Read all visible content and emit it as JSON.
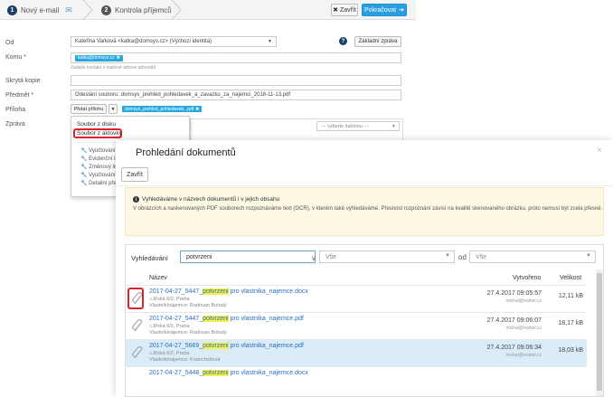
{
  "steps": [
    {
      "num": "1",
      "label": "Nový e-mail"
    },
    {
      "num": "2",
      "label": "Kontrola příjemců"
    }
  ],
  "toolbar": {
    "close_label": "Zavřít",
    "continue_label": "Pokračovat"
  },
  "form": {
    "from_label": "Od",
    "from_value": "Kateřina Varková <katka@domsys.cz> (Výchozí identita)",
    "basic_view_label": "Základní zpráva",
    "to_label": "Komu *",
    "to_chip": "katka@domsys.cz",
    "to_hint": "Zadejte kontakt v mailové adrese adresátů",
    "bcc_label": "Skrytá kopie",
    "subject_label": "Předmět *",
    "subject_value": "Odeslání souboru: domsys_prehled_pohledavek_a_zavazku_za_najemci_2018-11-13.pdf",
    "attachment_label": "Příloha",
    "attach_button": "Přidat přílohu",
    "attach_chip": "domsys_prehled_pohledavek...pdf",
    "message_label": "Zpráva",
    "template_select": "--- vyberte šablonu ---"
  },
  "dropdown": {
    "file_from_disk": "Soubor z disku",
    "file_from_dossier": "Soubor z aktovky",
    "sub_items": [
      "Vyúčtování z...",
      "Evidenční list",
      "Změnový list",
      "Vyúčtování fo",
      "Detailní přeh"
    ]
  },
  "modal": {
    "title": "Prohledání dokumentů",
    "close_button": "Zavřít",
    "close_x": "×",
    "info_title": "Vyhledáváme v názvech dokumentů i v jejich obsahu",
    "info_text": "V obrázcích a naskenovaných PDF souborech rozpoznáváme text (OCR), v kterém také vyhledáváme. Přesnost rozpoznání závisí na kvalitě skenovaného obrázku, proto nemusí být zcela přesné.",
    "search_label": "Vyhledávání",
    "search_value": "potvrzeni",
    "in_label": "v",
    "in_select": "Vše",
    "from_label": "od",
    "from_select": "Vše",
    "columns": {
      "name": "Název",
      "created": "Vytvořeno",
      "size": "Velikost"
    },
    "rows": [
      {
        "prefix": "2017-04-27_5447_",
        "highlight": "potvrzeni",
        "suffix": " pro vlastnika_najemce.docx",
        "line1": "Jiřská 6/2, Praha",
        "line2": "Vlastník/nájemce: Radovan Bohatý",
        "date": "27.4.2017 09:05:57",
        "user": "michal@vrabel.cz",
        "size": "12,11 kB"
      },
      {
        "prefix": "2017-04-27_5447_",
        "highlight": "potvrzeni",
        "suffix": " pro vlastnika_najemce.pdf",
        "line1": "Jiřská 6/2, Praha",
        "line2": "Vlastník/nájemce: Radovan Bohatý",
        "date": "27.4.2017 09:06:07",
        "user": "michal@vrabel.cz",
        "size": "18,17 kB"
      },
      {
        "prefix": "2017-04-27_5669_",
        "highlight": "potvrzeni",
        "suffix": " pro vlastnika_najemce.pdf",
        "line1": "Jiřská 6/2, Praha",
        "line2": "Vlastník/nájemce: Kratochvílová",
        "date": "27.4.2017 09:06:34",
        "user": "michal@vrabel.cz",
        "size": "18,03 kB"
      },
      {
        "prefix": "2017-04-27_5448_",
        "highlight": "potvrzeni",
        "suffix": " pro vlastnika_najemce.docx",
        "line1": "",
        "line2": "",
        "date": "",
        "user": "",
        "size": ""
      }
    ]
  }
}
